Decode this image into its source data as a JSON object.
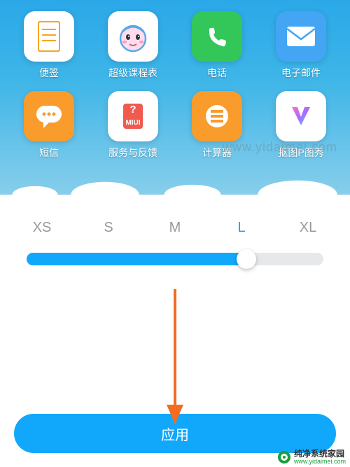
{
  "apps_row1": [
    {
      "label": "便签",
      "bg": "#ffffff",
      "icon": "notes"
    },
    {
      "label": "超级课程表",
      "bg": "#ffffff",
      "icon": "face"
    },
    {
      "label": "电话",
      "bg": "#33c75a",
      "icon": "phone"
    },
    {
      "label": "电子邮件",
      "bg": "#43a5f4",
      "icon": "mail"
    }
  ],
  "apps_row2": [
    {
      "label": "短信",
      "bg": "#f99c2c",
      "icon": "sms"
    },
    {
      "label": "服务与反馈",
      "bg": "#ffffff",
      "icon": "miui",
      "miui_text": "MIUI"
    },
    {
      "label": "计算器",
      "bg": "#f99c2c",
      "icon": "calc"
    },
    {
      "label": "抠图P图秀",
      "bg": "#ffffff",
      "icon": "ptu"
    }
  ],
  "sizes": [
    "XS",
    "S",
    "M",
    "L",
    "XL"
  ],
  "selected_index": 3,
  "slider_percent": 74,
  "apply_label": "应用",
  "watermark": "www.yidaimei.com",
  "footer_text": "纯净系统家园",
  "footer_url": "www.yidaimei.com",
  "accent": "#11a8fc",
  "arrow_color": "#f36c21"
}
